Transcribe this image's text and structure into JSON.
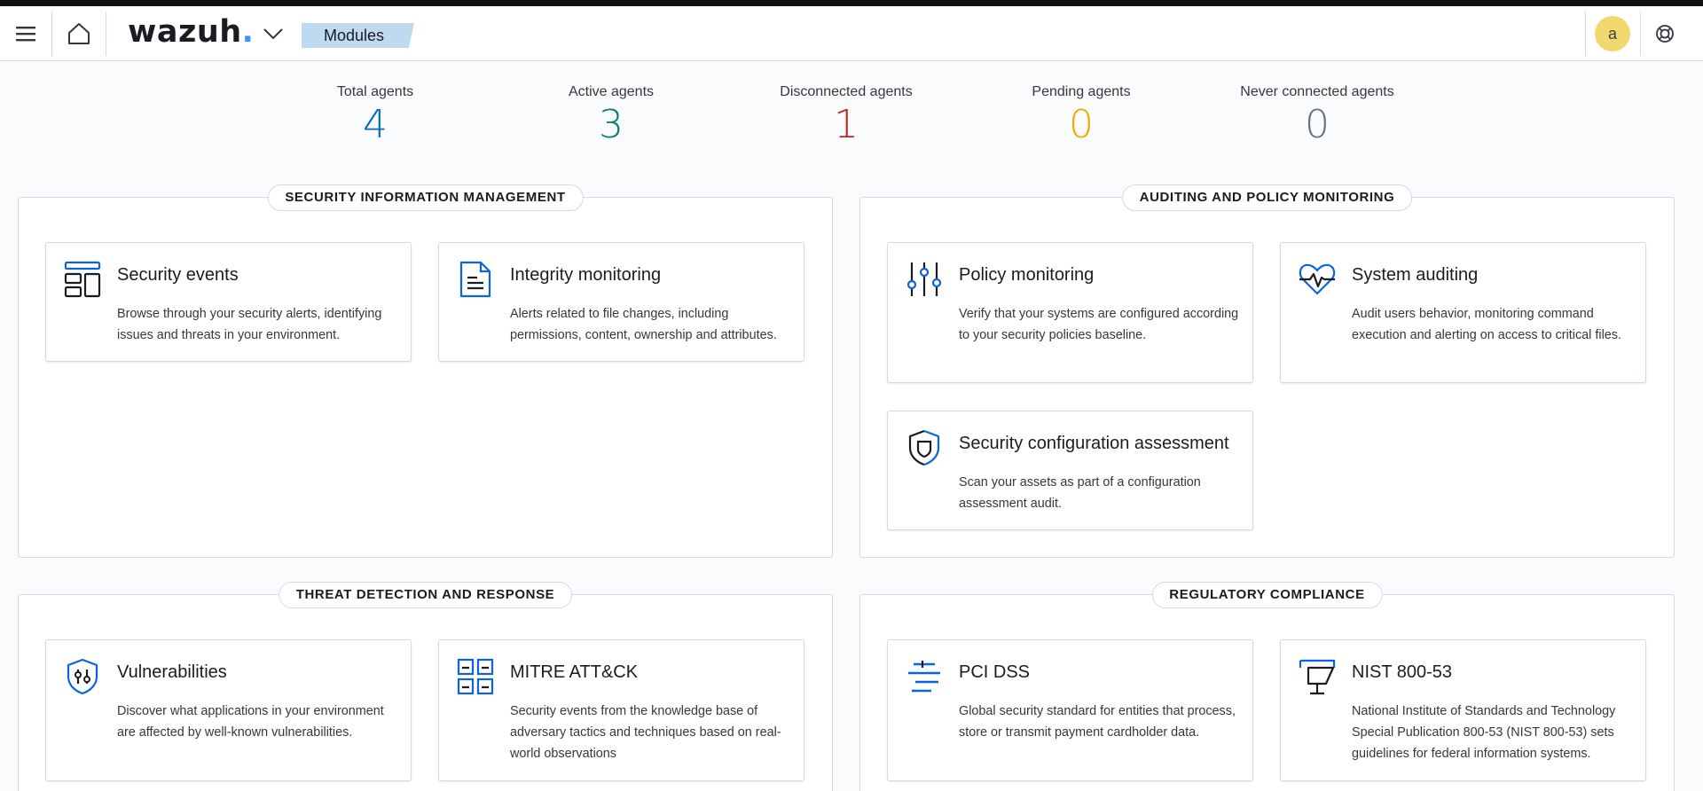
{
  "header": {
    "logo_text": "wazuh",
    "logo_dot": ".",
    "breadcrumb": "Modules",
    "avatar_initial": "a",
    "icons": [
      "menu-icon",
      "home-icon",
      "chevron-down-icon",
      "help-lifebuoy-icon"
    ]
  },
  "stats": [
    {
      "label": "Total agents",
      "value": "4",
      "color": "#006bb8"
    },
    {
      "label": "Active agents",
      "value": "3",
      "color": "#017d73"
    },
    {
      "label": "Disconnected agents",
      "value": "1",
      "color": "#bd271e"
    },
    {
      "label": "Pending agents",
      "value": "0",
      "color": "#f5a700"
    },
    {
      "label": "Never connected agents",
      "value": "0",
      "color": "#69707d"
    }
  ],
  "sections": [
    {
      "title": "SECURITY INFORMATION MANAGEMENT",
      "cards": [
        {
          "title": "Security events",
          "desc": "Browse through your security alerts, identifying issues and threats in your environment.",
          "icon": "layout-dashboard-icon"
        },
        {
          "title": "Integrity monitoring",
          "desc": "Alerts related to file changes, including permissions, content, ownership and attributes.",
          "icon": "document-icon"
        }
      ]
    },
    {
      "title": "AUDITING AND POLICY MONITORING",
      "cards": [
        {
          "title": "Policy monitoring",
          "desc": "Verify that your systems are configured according to your security policies baseline.",
          "icon": "sliders-icon"
        },
        {
          "title": "System auditing",
          "desc": "Audit users behavior, monitoring command execution and alerting on access to critical files.",
          "icon": "heart-pulse-icon"
        },
        {
          "title": "Security configuration assessment",
          "desc": "Scan your assets as part of a configuration assessment audit.",
          "icon": "shield-check-icon"
        }
      ]
    },
    {
      "title": "THREAT DETECTION AND RESPONSE",
      "cards": [
        {
          "title": "Vulnerabilities",
          "desc": "Discover what applications in your environment are affected by well-known vulnerabilities.",
          "icon": "shield-tools-icon"
        },
        {
          "title": "MITRE ATT&CK",
          "desc": "Security events from the knowledge base of adversary tactics and techniques based on real-world observations",
          "icon": "grid-icon"
        }
      ]
    },
    {
      "title": "REGULATORY COMPLIANCE",
      "cards": [
        {
          "title": "PCI DSS",
          "desc": "Global security standard for entities that process, store or transmit payment cardholder data.",
          "icon": "lines-icon"
        },
        {
          "title": "NIST 800-53",
          "desc": "National Institute of Standards and Technology Special Publication 800-53 (NIST 800-53) sets guidelines for federal information systems.",
          "icon": "podium-icon"
        }
      ]
    }
  ],
  "colors": {
    "accent_blue": "#006bb8",
    "icon_blue": "#0b64dd",
    "logo_dot": "#3595f9"
  }
}
